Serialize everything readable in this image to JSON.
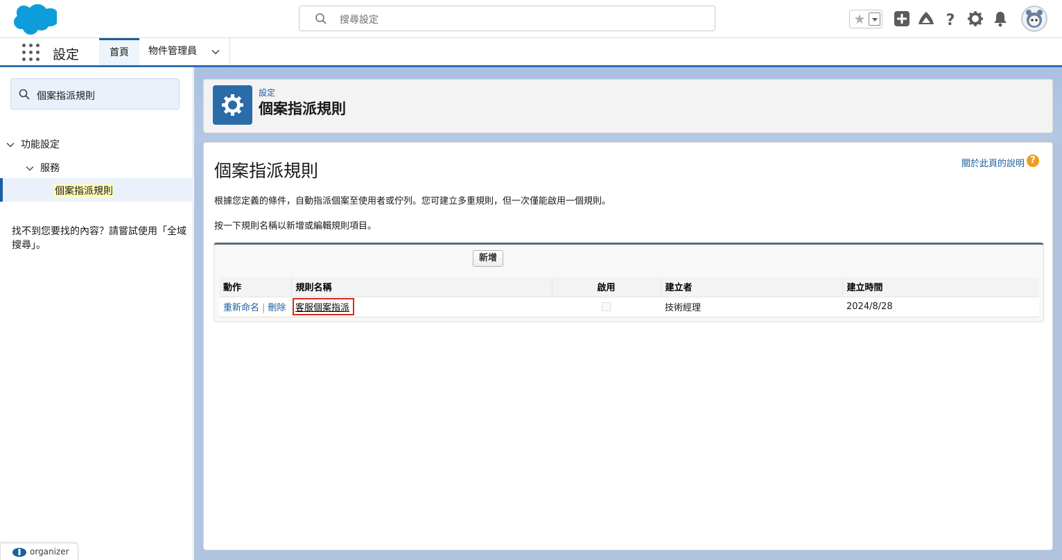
{
  "header": {
    "search_placeholder": "搜尋設定",
    "icons": [
      "salesforce-cloud-icon",
      "search-icon",
      "star-icon",
      "chevron-down-icon",
      "plus-icon",
      "trailhead-icon",
      "help-icon",
      "gear-icon",
      "bell-icon",
      "avatar"
    ]
  },
  "context_bar": {
    "app_name": "設定",
    "tabs": [
      {
        "label": "首頁",
        "active": true
      },
      {
        "label": "物件管理員",
        "active": false
      }
    ]
  },
  "sidebar": {
    "quick_find_value": "個案指派規則",
    "tree": [
      {
        "label": "功能設定",
        "expanded": true
      },
      {
        "label": "服務",
        "expanded": true
      },
      {
        "label": "個案指派規則",
        "selected": true
      }
    ],
    "not_found": "找不到您要找的內容？請嘗試使用「全域搜尋」。",
    "organizer_label": "organizer"
  },
  "page_header": {
    "breadcrumb": "設定",
    "title": "個案指派規則"
  },
  "content": {
    "title": "個案指派規則",
    "help_link": "關於此頁的說明",
    "help_icon_glyph": "?",
    "description": "根據您定義的條件，自動指派個案至使用者或佇列。您可建立多重規則，但一次僅能啟用一個規則。",
    "instruction": "按一下規則名稱以新增或編輯規則項目。",
    "new_button": "新增",
    "table": {
      "headers": [
        "動作",
        "規則名稱",
        "啟用",
        "建立者",
        "建立時間"
      ],
      "rows": [
        {
          "actions": [
            "重新命名",
            "刪除"
          ],
          "action_separator": "|",
          "name": "客服個案指派",
          "active": false,
          "created_by": "技術經理",
          "created_date": "2024/8/28"
        }
      ]
    }
  },
  "colors": {
    "brand_blue": "#1b5f9e",
    "header_icon_bg": "#2a6ca7",
    "highlight_box": "#d9281c",
    "search_highlight": "#fffcb8",
    "help_orange": "#f29c1f"
  }
}
